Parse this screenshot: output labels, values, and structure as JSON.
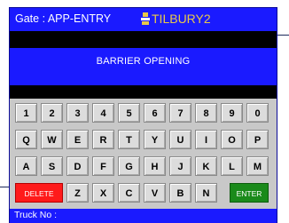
{
  "header": {
    "gate_label": "Gate : APP-ENTRY",
    "logo_text": "TILBURY2"
  },
  "message": {
    "status": "BARRIER OPENING"
  },
  "keypad": {
    "row1": [
      "1",
      "2",
      "3",
      "4",
      "5",
      "6",
      "7",
      "8",
      "9",
      "0"
    ],
    "row2": [
      "Q",
      "W",
      "E",
      "R",
      "T",
      "Y",
      "U",
      "I",
      "O",
      "P"
    ],
    "row3": [
      "A",
      "S",
      "D",
      "F",
      "G",
      "H",
      "J",
      "K",
      "L",
      "M"
    ],
    "row4": [
      "DELETE",
      "Z",
      "X",
      "C",
      "V",
      "B",
      "N",
      "ENTER"
    ]
  },
  "footer": {
    "truck_label": "Truck No :"
  },
  "colors": {
    "screen_blue": "#1a1aff",
    "delete_red": "#ff1a1a",
    "enter_green": "#1a8a1a",
    "key_grey": "#dcdcdc",
    "logo_gold": "#e8c84a"
  }
}
